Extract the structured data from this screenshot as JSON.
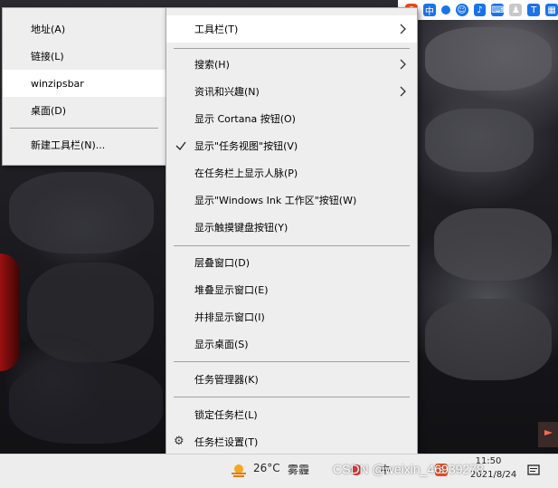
{
  "tray_top": {
    "icons": [
      "sogou-s-icon",
      "ime-zh-icon",
      "settings-dot-icon",
      "emoji-icon",
      "microphone-icon",
      "keyboard-icon",
      "user-icon",
      "shirt-icon",
      "grid-icon"
    ]
  },
  "toolbars_submenu": {
    "items": [
      {
        "label": "地址(A)"
      },
      {
        "label": "链接(L)"
      },
      {
        "label": "winzipsbar"
      },
      {
        "label": "桌面(D)"
      },
      {
        "label": "新建工具栏(N)..."
      }
    ]
  },
  "context_menu": {
    "items": [
      {
        "label": "工具栏(T)"
      },
      {
        "label": "搜索(H)"
      },
      {
        "label": "资讯和兴趣(N)"
      },
      {
        "label": "显示 Cortana 按钮(O)"
      },
      {
        "label": "显示\"任务视图\"按钮(V)"
      },
      {
        "label": "在任务栏上显示人脉(P)"
      },
      {
        "label": "显示\"Windows Ink 工作区\"按钮(W)"
      },
      {
        "label": "显示触摸键盘按钮(Y)"
      },
      {
        "label": "层叠窗口(D)"
      },
      {
        "label": "堆叠显示窗口(E)"
      },
      {
        "label": "并排显示窗口(I)"
      },
      {
        "label": "显示桌面(S)"
      },
      {
        "label": "任务管理器(K)"
      },
      {
        "label": "锁定任务栏(L)"
      },
      {
        "label": "任务栏设置(T)"
      }
    ]
  },
  "taskbar": {
    "temperature": "26°C",
    "weather": "雾霾",
    "ime": "中",
    "clock_time": "11:50",
    "clock_date": "2021/8/24"
  },
  "watermark": "CSDN @weixin_46939278"
}
